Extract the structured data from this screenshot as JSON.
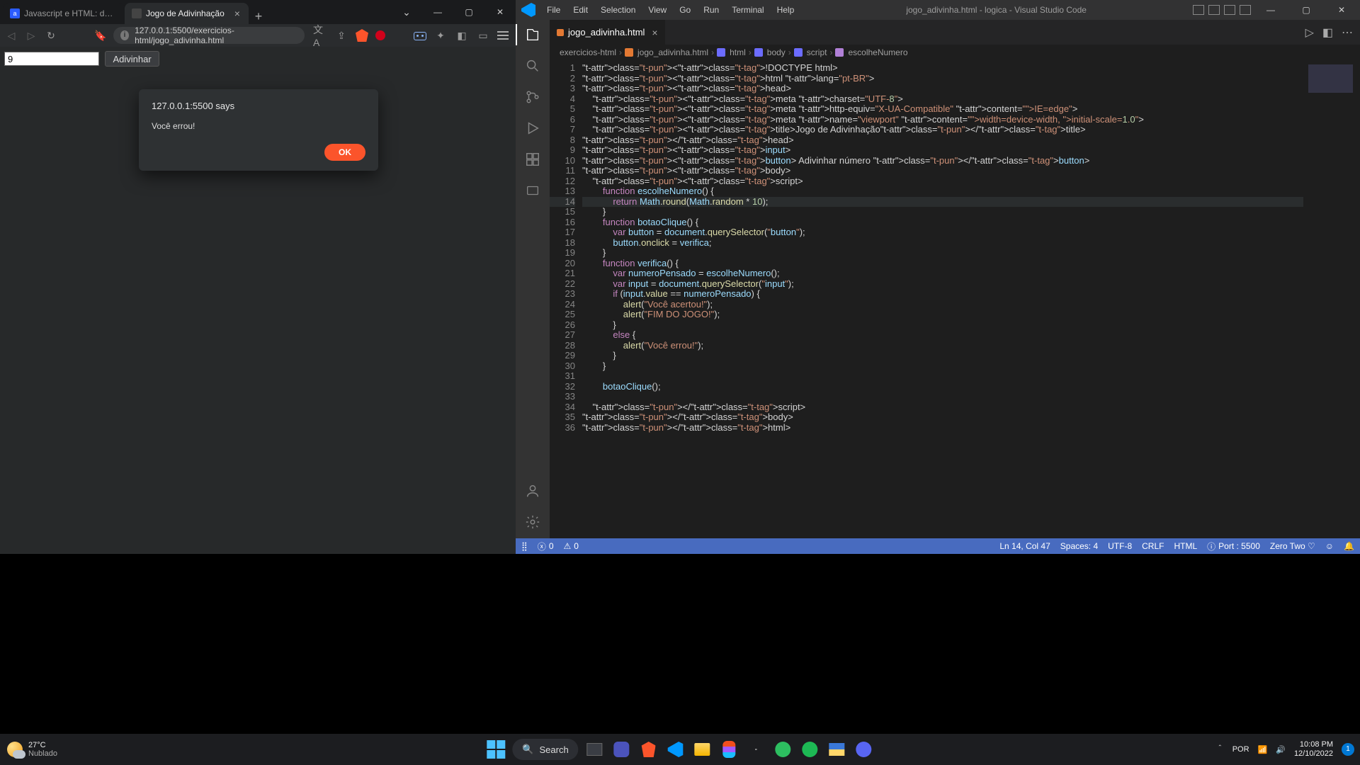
{
  "browser": {
    "tabs": [
      {
        "label": "Javascript e HTML: desenvolva um jog",
        "active": false
      },
      {
        "label": "Jogo de Adivinhação",
        "active": true
      }
    ],
    "url": "127.0.0.1:5500/exercicios-html/jogo_adivinha.html",
    "page": {
      "input_value": "9",
      "button_label": "Adivinhar"
    },
    "dialog": {
      "title": "127.0.0.1:5500 says",
      "message": "Você errou!",
      "ok": "OK"
    }
  },
  "vscode": {
    "menu": [
      "File",
      "Edit",
      "Selection",
      "View",
      "Go",
      "Run",
      "Terminal",
      "Help"
    ],
    "window_title": "jogo_adivinha.html - logica - Visual Studio Code",
    "tab": {
      "filename": "jogo_adivinha.html"
    },
    "breadcrumbs": [
      "exercicios-html",
      "jogo_adivinha.html",
      "html",
      "body",
      "script",
      "escolheNumero"
    ],
    "status": {
      "errors": "0",
      "warnings": "0",
      "cursor": "Ln 14, Col 47",
      "spaces": "Spaces: 4",
      "encoding": "UTF-8",
      "eol": "CRLF",
      "lang": "HTML",
      "port": "Port : 5500",
      "theme": "Zero Two ♡",
      "bell": "🔔"
    },
    "code_plain": [
      "<!DOCTYPE html>",
      "<html lang=\"pt-BR\">",
      "<head>",
      "    <meta charset=\"UTF-8\">",
      "    <meta http-equiv=\"X-UA-Compatible\" content=\"IE=edge\">",
      "    <meta name=\"viewport\" content=\"width=device-width, initial-scale=1.0\">",
      "    <title>Jogo de Adivinhação</title>",
      "</head>",
      "<input>",
      "<button> Adivinhar número </button>",
      "<body>",
      "    <script>",
      "        function escolheNumero() {",
      "            return Math.round(Math.random * 10);",
      "        }",
      "        function botaoClique() {",
      "            var button = document.querySelector(\"button\");",
      "            button.onclick = verifica;",
      "        }",
      "        function verifica() {",
      "            var numeroPensado = escolheNumero();",
      "            var input = document.querySelector(\"input\");",
      "            if (input.value == numeroPensado) {",
      "                alert(\"Você acertou!\");",
      "                alert(\"FIM DO JOGO!\");",
      "            }",
      "            else {",
      "                alert(\"Você errou!\");",
      "            }",
      "        }",
      "",
      "        botaoClique();",
      "",
      "    </script>",
      "</body>",
      "</html>"
    ],
    "highlight_line": 14
  },
  "taskbar": {
    "weather_temp": "27°C",
    "weather_desc": "Nublado",
    "search_placeholder": "Search",
    "lang": "POR",
    "time": "10:08 PM",
    "date": "12/10/2022",
    "notif_count": "1"
  }
}
